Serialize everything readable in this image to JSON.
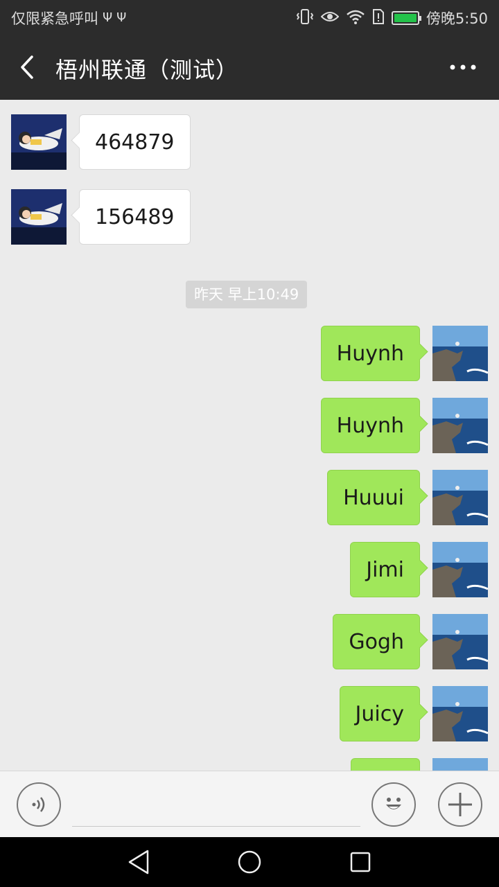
{
  "status_bar": {
    "carrier": "仅限紧急呼叫",
    "usb_icons": [
      "usb-icon",
      "usb-icon"
    ],
    "right_icons": [
      "vibrate-icon",
      "eye-icon",
      "wifi-icon",
      "sim-alert-icon",
      "battery-icon"
    ],
    "battery_level": 1.0,
    "battery_color": "#24c24a",
    "time": "傍晚5:50"
  },
  "header": {
    "back_icon": "chevron-left-icon",
    "title": "梧州联通（测试）",
    "more_icon": "more-dots-icon",
    "bg_color": "#2c2c2c"
  },
  "chat": {
    "incoming": [
      {
        "text": "464879"
      },
      {
        "text": "156489"
      }
    ],
    "timestamp": "昨天 早上10:49",
    "outgoing": [
      {
        "text": "Huynh"
      },
      {
        "text": "Huynh"
      },
      {
        "text": "Huuui"
      },
      {
        "text": "Jimi"
      },
      {
        "text": "Gogh"
      },
      {
        "text": "Juicy"
      },
      {
        "text": ""
      }
    ],
    "incoming_bubble_color": "#ffffff",
    "outgoing_bubble_color": "#a0e75a"
  },
  "input_bar": {
    "voice_icon": "voice-icon",
    "emoji_icon": "emoji-icon",
    "plus_icon": "plus-icon",
    "value": ""
  },
  "nav_bar": {
    "back_icon": "nav-back-icon",
    "home_icon": "nav-home-icon",
    "recent_icon": "nav-recent-icon"
  }
}
